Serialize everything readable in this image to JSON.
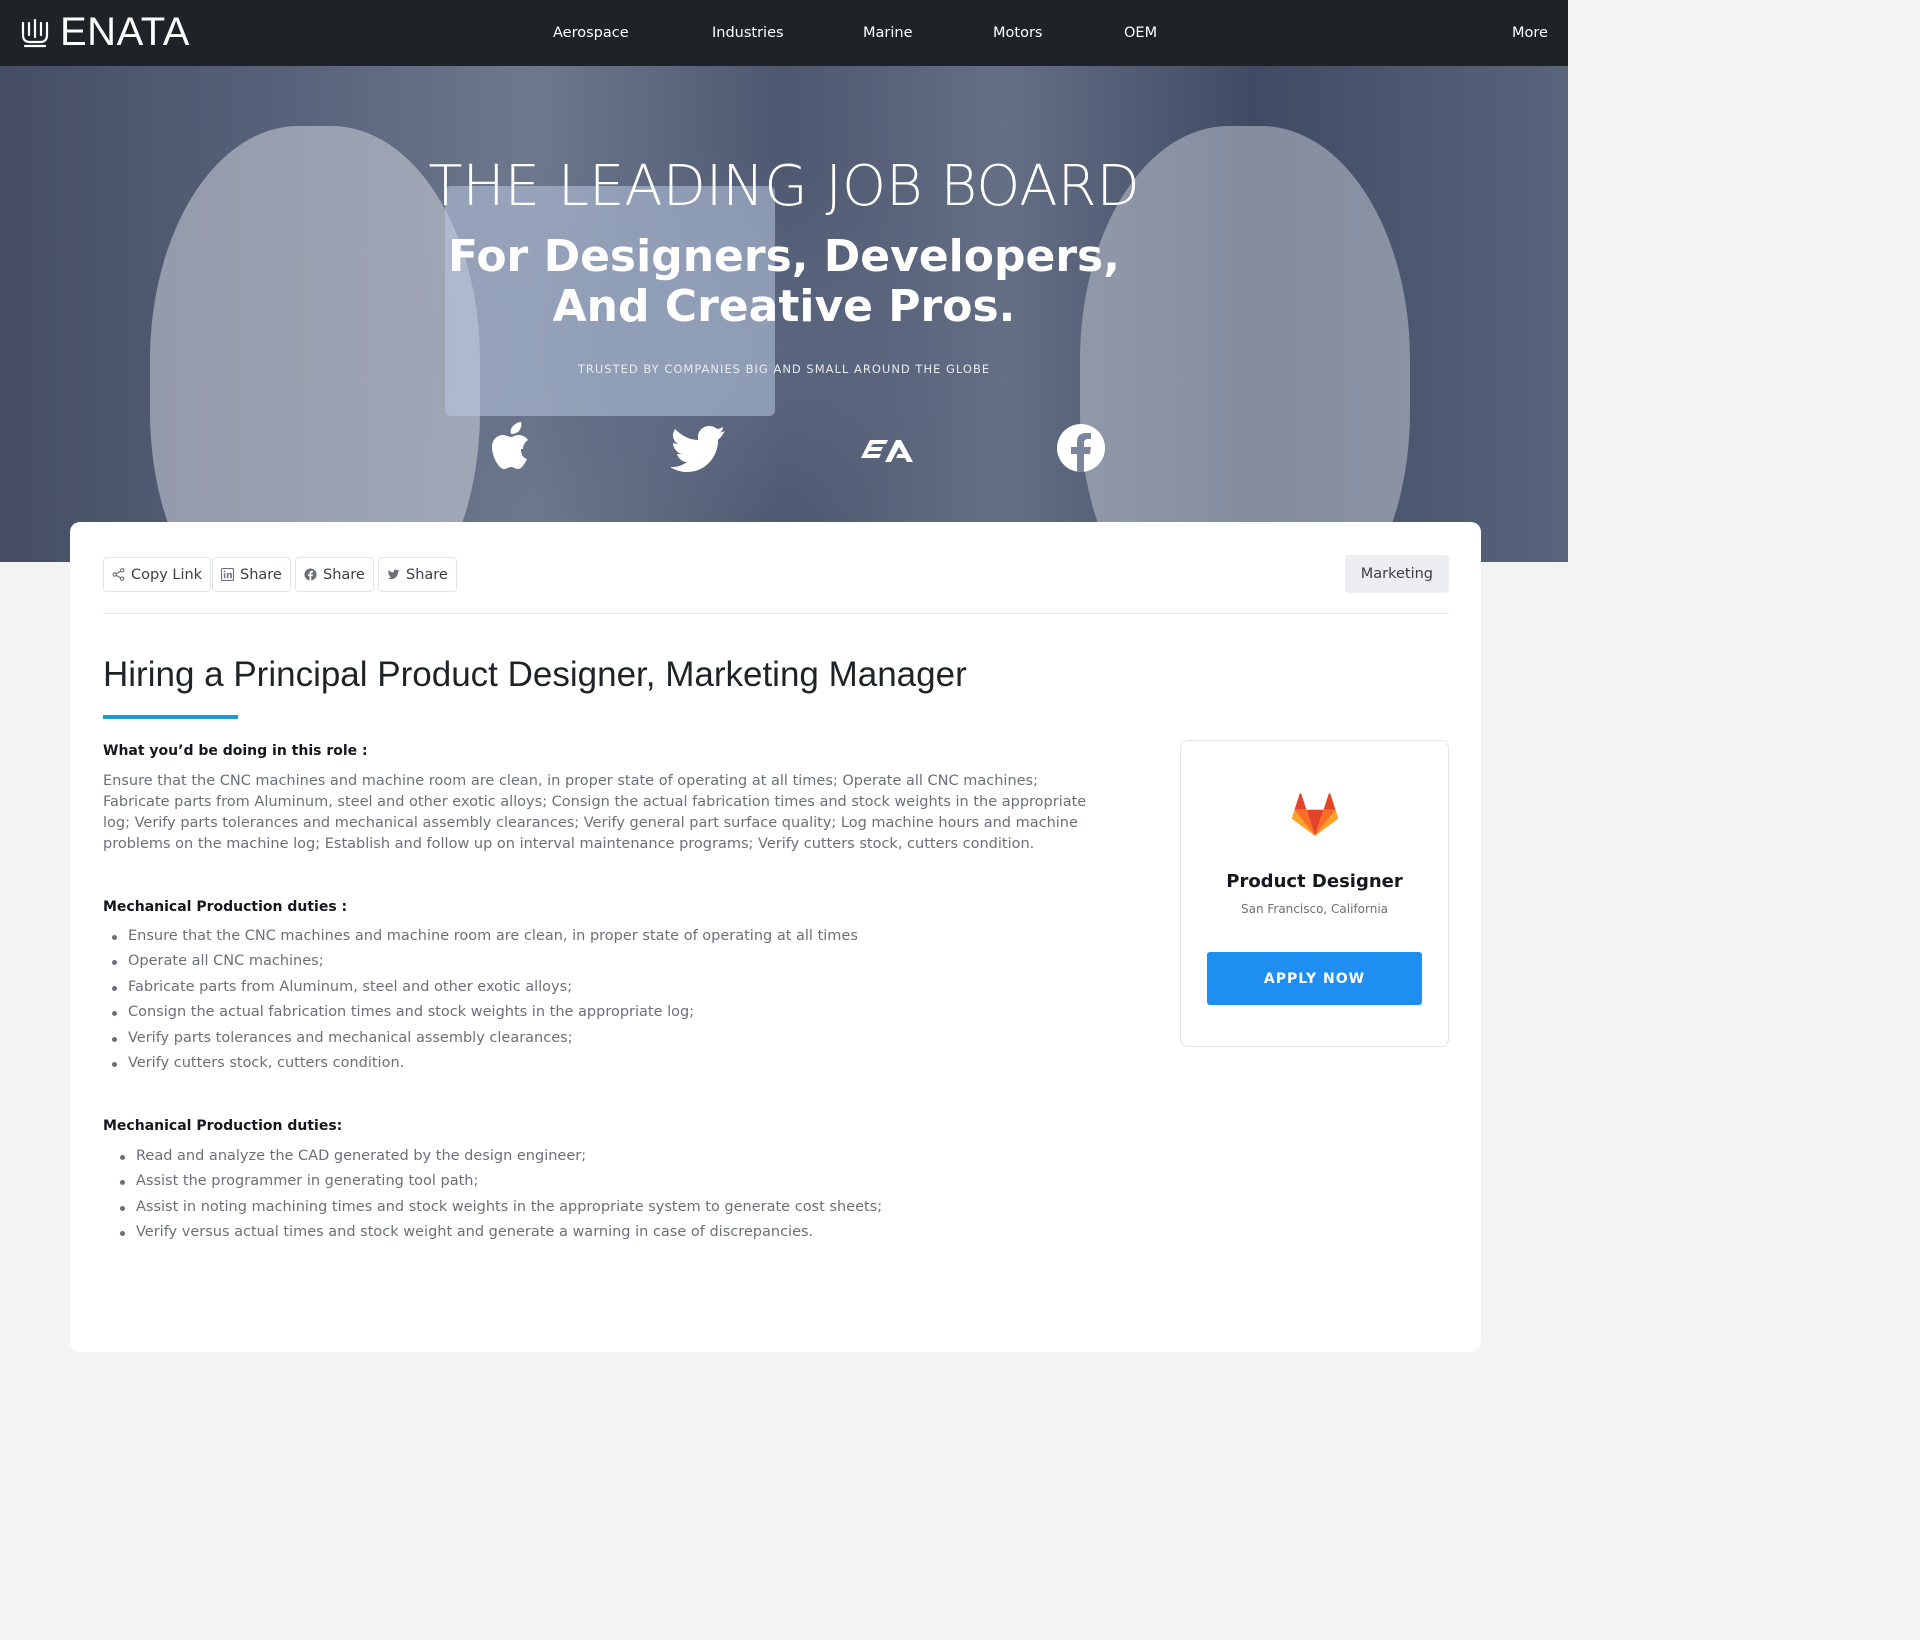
{
  "brand": {
    "name": "ENATA"
  },
  "nav": {
    "items": [
      "Aerospace",
      "Industries",
      "Marine",
      "Motors",
      "OEM"
    ],
    "more": "More"
  },
  "hero": {
    "title": "THE LEADING JOB BOARD",
    "subtitle_line1": "For Designers, Developers,",
    "subtitle_line2": "And Creative Pros.",
    "trusted": "TRUSTED BY COMPANIES BIG AND SMALL AROUND THE GLOBE",
    "brands": [
      "apple-icon",
      "twitter-icon",
      "ea-icon",
      "facebook-icon"
    ]
  },
  "share": {
    "copy_link": "Copy Link",
    "linkedin": "Share",
    "facebook": "Share",
    "twitter": "Share",
    "tag": "Marketing"
  },
  "job": {
    "title": "Hiring a Principal Product Designer, Marketing Manager",
    "role_heading": "What you’d be doing in this role :",
    "role_text": "Ensure that the CNC machines and machine room are clean, in proper state of operating at all times; Operate all CNC machines; Fabricate parts from Aluminum, steel and other exotic alloys; Consign the actual fabrication times and stock weights in the appropriate log; Verify parts tolerances and mechanical assembly clearances; Verify general part surface quality; Log machine hours and machine problems on the machine log; Establish and follow up on interval maintenance programs; Verify cutters stock, cutters condition.",
    "duties1_heading": "Mechanical Production duties :",
    "duties1": [
      "Ensure that the CNC machines and machine room are clean, in proper state of operating at all times",
      "Operate all CNC machines;",
      "Fabricate parts from Aluminum, steel and other exotic alloys;",
      "Consign the actual fabrication times and stock weights in the appropriate log;",
      "Verify parts tolerances and mechanical assembly clearances;",
      "Verify cutters stock, cutters condition."
    ],
    "duties2_heading": "Mechanical Production duties:",
    "duties2": [
      "Read and analyze the CAD generated by the design engineer;",
      "Assist the programmer in generating tool path;",
      "Assist in noting machining times and stock weights in the appropriate system to generate cost sheets;",
      "Verify versus actual times and stock weight and generate a warning in case of discrepancies."
    ]
  },
  "side_card": {
    "icon": "gitlab-icon",
    "title": "Product Designer",
    "location": "San Francisco, California",
    "apply": "APPLY NOW"
  },
  "colors": {
    "navbar": "#1e2328",
    "accent": "#1b9ad6",
    "apply_button": "#1e8ef0"
  }
}
